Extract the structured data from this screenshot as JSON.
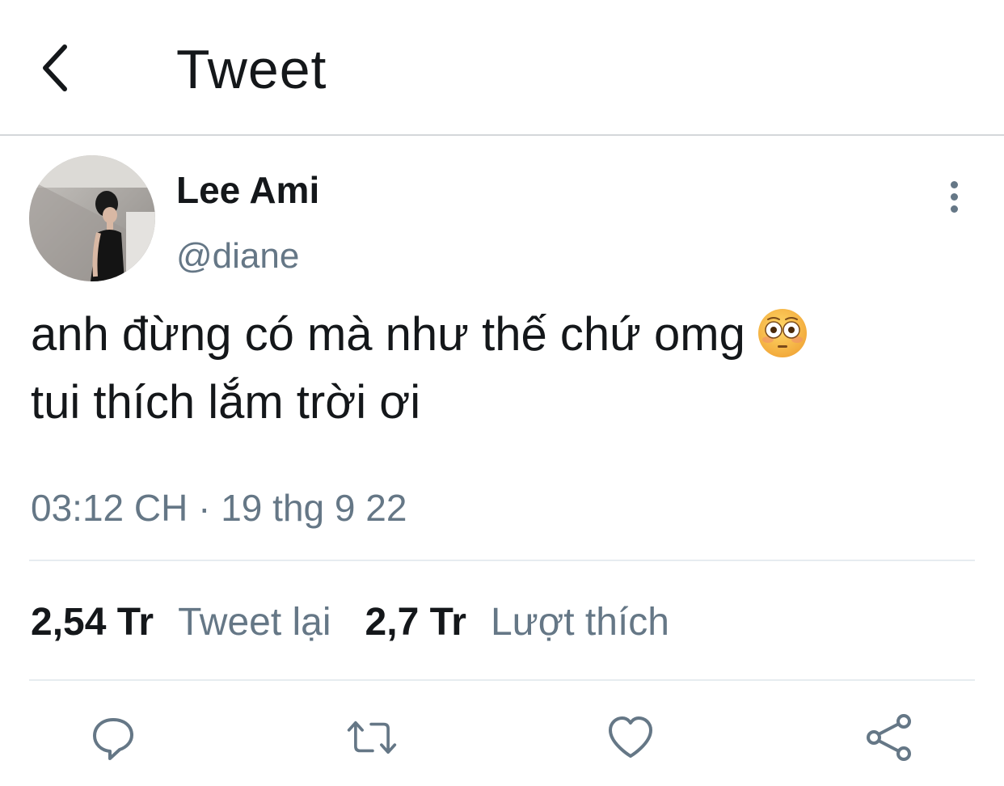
{
  "header": {
    "back_icon": "chevron-left-icon",
    "title": "Tweet"
  },
  "tweet": {
    "author": {
      "display_name": "Lee Ami",
      "handle": "@diane",
      "avatar": "avatar-photo"
    },
    "more_icon": "more-vertical-icon",
    "text_lines": [
      "anh đừng có mà như thế chứ omg",
      "tui thích lắm trời ơi"
    ],
    "emoji": "flushed-face",
    "timestamp": "03:12 CH · 19 thg 9 22",
    "stats": {
      "retweets_count": "2,54 Tr",
      "retweets_label": "Tweet lại",
      "likes_count": "2,7 Tr",
      "likes_label": "Lượt thích"
    },
    "actions": [
      {
        "name": "reply",
        "icon": "comment-icon"
      },
      {
        "name": "retweet",
        "icon": "retweet-icon"
      },
      {
        "name": "like",
        "icon": "heart-icon"
      },
      {
        "name": "share",
        "icon": "share-icon"
      }
    ]
  },
  "colors": {
    "text_primary": "#14171a",
    "text_secondary": "#657786",
    "divider": "#e6ecf0"
  }
}
